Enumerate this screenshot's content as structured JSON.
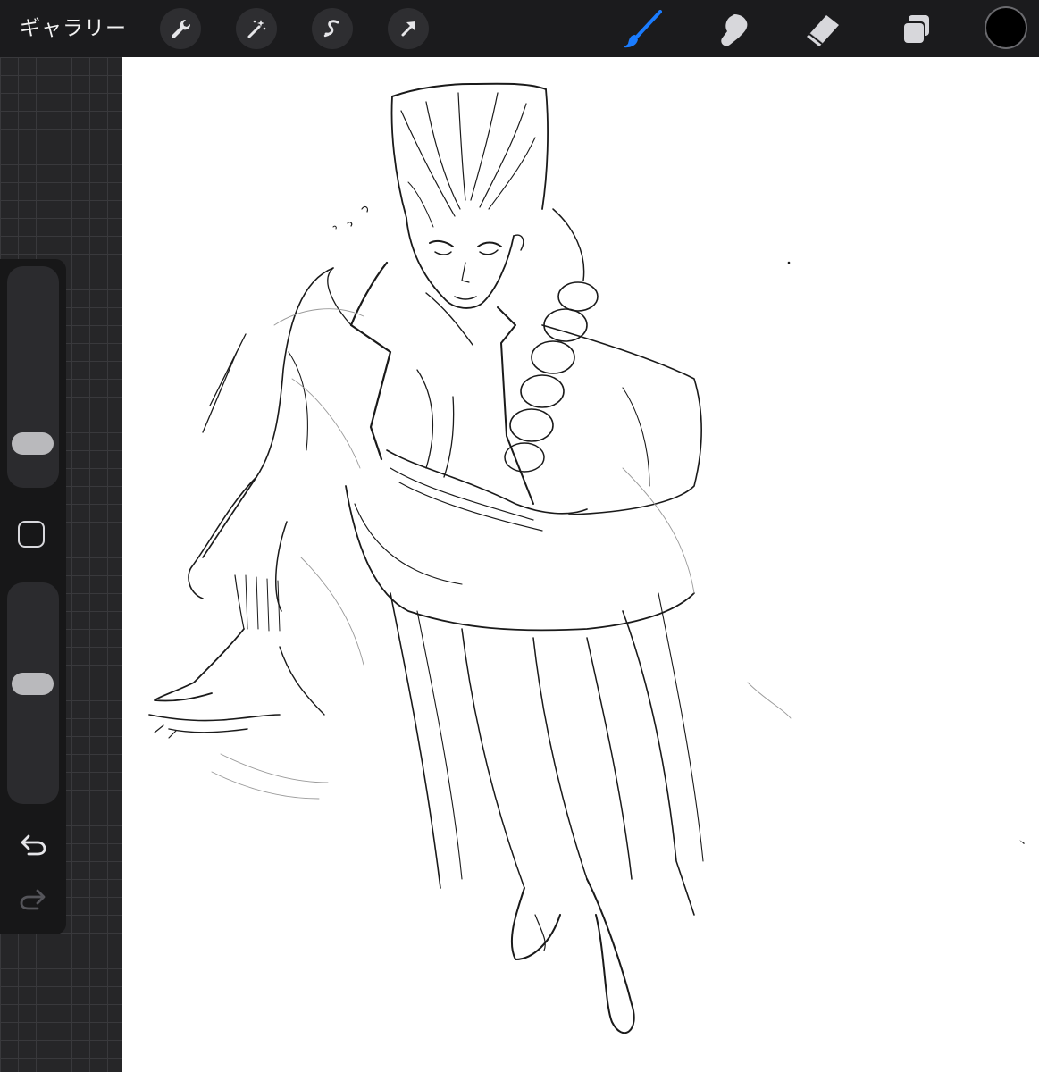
{
  "topbar": {
    "gallery_label": "ギャラリー",
    "tools_left": [
      {
        "name": "actions",
        "icon": "wrench-icon"
      },
      {
        "name": "adjustments",
        "icon": "magic-wand-icon"
      },
      {
        "name": "selection",
        "icon": "selection-s-icon"
      },
      {
        "name": "transform",
        "icon": "arrow-cursor-icon"
      }
    ],
    "tools_right": [
      {
        "name": "brush",
        "icon": "brush-icon",
        "active": true
      },
      {
        "name": "smudge",
        "icon": "smudge-finger-icon",
        "active": false
      },
      {
        "name": "eraser",
        "icon": "eraser-icon",
        "active": false
      },
      {
        "name": "layers",
        "icon": "layers-icon",
        "active": false
      }
    ],
    "current_color": "#000000"
  },
  "sidebar": {
    "brush_size_level": 0.15,
    "opacity_level": 0.55,
    "undo_icon": "undo-arrow-icon",
    "redo_icon": "redo-arrow-icon"
  },
  "colors": {
    "active_tool": "#1a7cff",
    "inactive_tool": "#d7d7db",
    "topbar_bg": "#1b1b1d",
    "canvas_bg": "#ffffff",
    "sketch_stroke": "#1a1a1a"
  }
}
